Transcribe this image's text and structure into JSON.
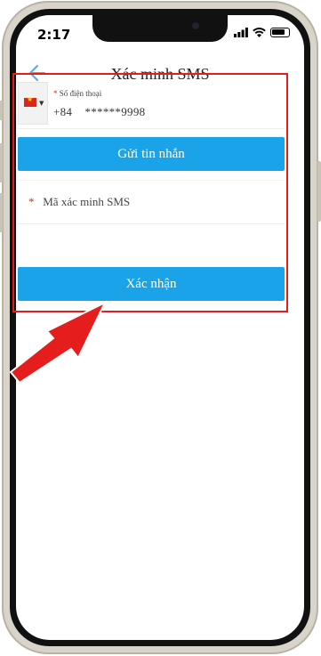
{
  "status_bar": {
    "time": "2:17"
  },
  "header": {
    "title": "Xác minh SMS"
  },
  "form": {
    "phone_label": "Số điện thoại",
    "phone_prefix": "+84",
    "phone_masked": "******9998",
    "send_button": "Gửi tin nhắn",
    "code_label": "Mã xác minh SMS",
    "confirm_button": "Xác nhận"
  },
  "icons": {
    "back": "back-arrow-icon",
    "flag": "vietnam-flag-icon",
    "signal": "signal-icon",
    "wifi": "wifi-icon",
    "battery": "battery-icon"
  },
  "colors": {
    "accent": "#1aa3e8",
    "highlight": "#e01e1e",
    "required": "#e0262b"
  }
}
